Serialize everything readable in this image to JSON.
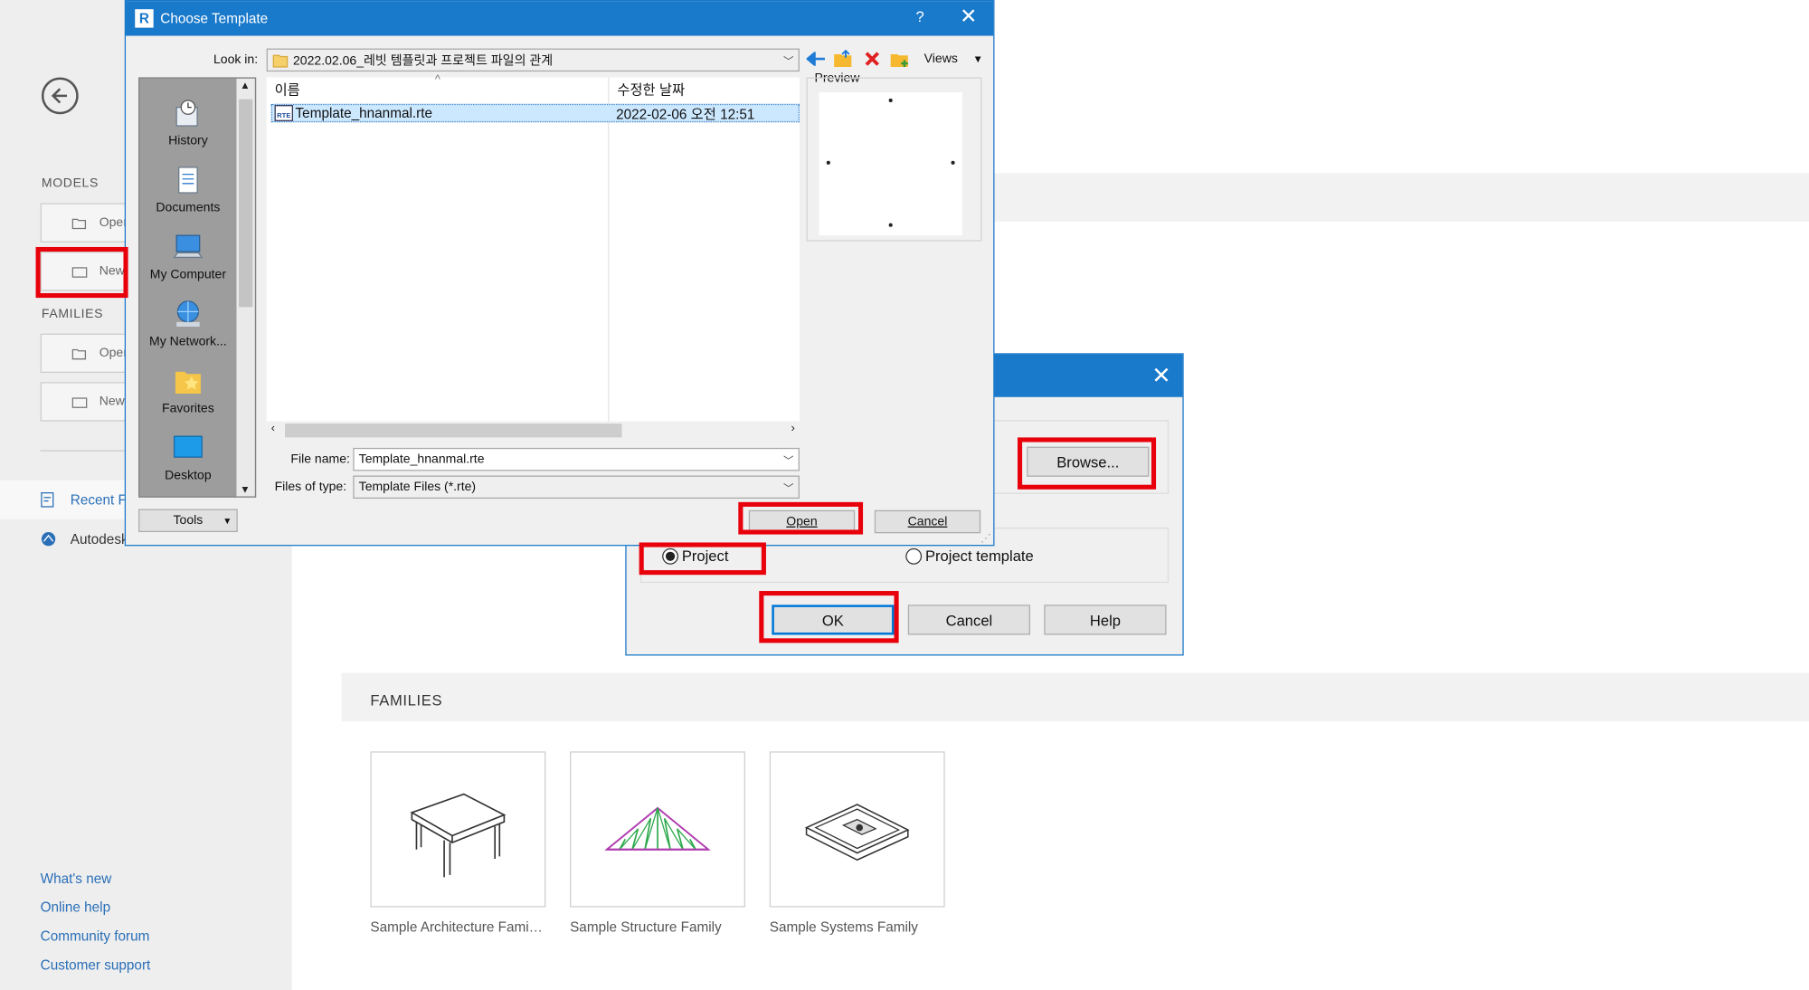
{
  "home": {
    "models_label": "MODELS",
    "families_label": "FAMILIES",
    "models_open": "Open…",
    "models_new": "New…",
    "families_open": "Open…",
    "families_new": "New…",
    "recent_label": "Recent Files",
    "autodesk_label": "Autodesk Docs",
    "links": [
      "What's new",
      "Online help",
      "Community forum",
      "Customer support"
    ],
    "families_section_title": "FAMILIES",
    "family_cards": [
      {
        "caption": "Sample Architecture Fami…"
      },
      {
        "caption": "Sample Structure Family"
      },
      {
        "caption": "Sample Systems Family"
      }
    ]
  },
  "new_project_dialog": {
    "browse_label": "Browse...",
    "create_new_options": [
      "Project",
      "Project template"
    ],
    "selected": "Project",
    "ok_label": "OK",
    "cancel_label": "Cancel",
    "help_label": "Help"
  },
  "choose_template_dialog": {
    "title": "Choose Template",
    "help_glyph": "?",
    "look_in_label": "Look in:",
    "look_in_value": "2022.02.06_레빗 템플릿과 프로젝트 파일의 관계",
    "views_label": "Views",
    "preview_label": "Preview",
    "places": [
      "History",
      "Documents",
      "My Computer",
      "My Network...",
      "Favorites",
      "Desktop"
    ],
    "columns": {
      "name": "이름",
      "modified": "수정한 날짜"
    },
    "files": [
      {
        "name": "Template_hnanmal.rte",
        "modified": "2022-02-06 오전 12:51",
        "icon_text": "RTE"
      }
    ],
    "file_name_label": "File name:",
    "file_name_value": "Template_hnanmal.rte",
    "files_of_type_label": "Files of type:",
    "files_of_type_value": "Template Files  (*.rte)",
    "tools_label": "Tools",
    "open_label": "Open",
    "cancel_label": "Cancel"
  },
  "colors": {
    "titlebar": "#1979ca",
    "highlight": "#e8000b",
    "link": "#2a6fb8",
    "selection": "#cce8ff"
  }
}
